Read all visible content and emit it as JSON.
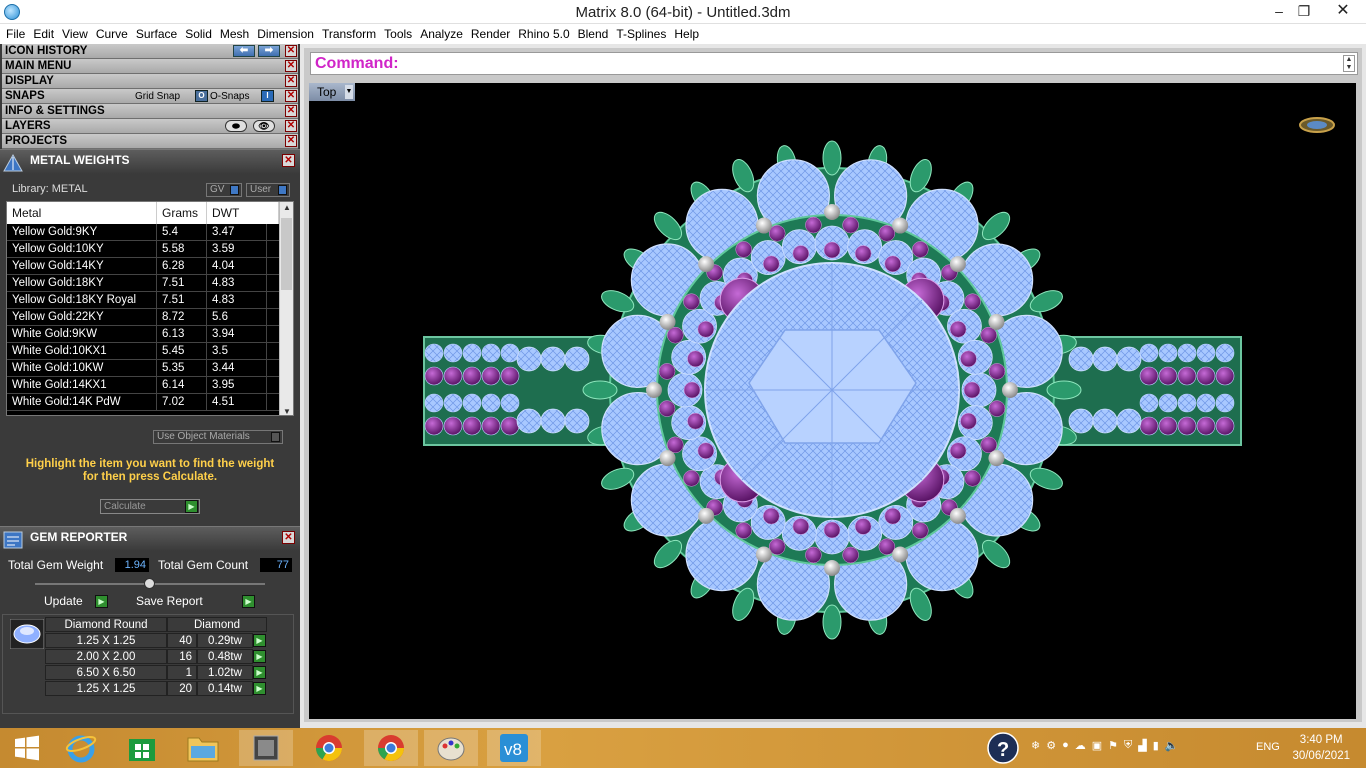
{
  "window": {
    "title": "Matrix 8.0 (64-bit) - Untitled.3dm",
    "minimize_icon": "–",
    "restore_icon": "❐",
    "close_icon": "✕"
  },
  "menu": [
    "File",
    "Edit",
    "View",
    "Curve",
    "Surface",
    "Solid",
    "Mesh",
    "Dimension",
    "Transform",
    "Tools",
    "Analyze",
    "Render",
    "Rhino 5.0",
    "Blend",
    "T-Splines",
    "Help"
  ],
  "panel": {
    "icon_history": "ICON HISTORY",
    "main_menu": "MAIN MENU",
    "display": "DISPLAY",
    "snaps": "SNAPS",
    "grid_snap": "Grid Snap",
    "o_snaps": "O-Snaps",
    "info_settings": "INFO & SETTINGS",
    "layers": "LAYERS",
    "projects": "PROJECTS"
  },
  "metal_weights": {
    "title": "METAL WEIGHTS",
    "library": "Library: METAL",
    "gv_label": "GV",
    "user_label": "User",
    "columns": [
      "Metal",
      "Grams",
      "DWT"
    ],
    "rows": [
      {
        "metal": "Yellow Gold:9KY",
        "grams": "5.4",
        "dwt": "3.47"
      },
      {
        "metal": "Yellow Gold:10KY",
        "grams": "5.58",
        "dwt": "3.59"
      },
      {
        "metal": "Yellow Gold:14KY",
        "grams": "6.28",
        "dwt": "4.04"
      },
      {
        "metal": "Yellow Gold:18KY",
        "grams": "7.51",
        "dwt": "4.83"
      },
      {
        "metal": "Yellow Gold:18KY Royal",
        "grams": "7.51",
        "dwt": "4.83"
      },
      {
        "metal": "Yellow Gold:22KY",
        "grams": "8.72",
        "dwt": "5.6"
      },
      {
        "metal": "White Gold:9KW",
        "grams": "6.13",
        "dwt": "3.94"
      },
      {
        "metal": "White Gold:10KX1",
        "grams": "5.45",
        "dwt": "3.5"
      },
      {
        "metal": "White Gold:10KW",
        "grams": "5.35",
        "dwt": "3.44"
      },
      {
        "metal": "White Gold:14KX1",
        "grams": "6.14",
        "dwt": "3.95"
      },
      {
        "metal": "White Gold:14K PdW",
        "grams": "7.02",
        "dwt": "4.51"
      }
    ],
    "use_object_materials": "Use Object Materials",
    "hint_line1": "Highlight the item you want to find the weight",
    "hint_line2": "for then press Calculate.",
    "calculate": "Calculate"
  },
  "gem_reporter": {
    "title": "GEM REPORTER",
    "total_weight_label": "Total Gem Weight",
    "total_weight": "1.94",
    "total_count_label": "Total Gem Count",
    "total_count": "77",
    "update": "Update",
    "save_report": "Save Report",
    "col_shape": "Diamond Round",
    "col_type": "Diamond",
    "rows": [
      {
        "size": "1.25 X 1.25",
        "count": "40",
        "weight": "0.29tw"
      },
      {
        "size": "2.00 X 2.00",
        "count": "16",
        "weight": "0.48tw"
      },
      {
        "size": "6.50 X 6.50",
        "count": "1",
        "weight": "1.02tw"
      },
      {
        "size": "1.25 X 1.25",
        "count": "20",
        "weight": "0.14tw"
      }
    ]
  },
  "command": {
    "label": "Command:"
  },
  "viewport": {
    "view_name": "Top"
  },
  "taskbar": {
    "language": "ENG",
    "time": "3:40 PM",
    "date": "30/06/2021"
  },
  "colors": {
    "accent_command": "#d025c8",
    "hint": "#ffd04a",
    "gem_blue": "#9ec9ff",
    "metal_green": "#1f7a55",
    "amethyst": "#7a2a8a"
  }
}
